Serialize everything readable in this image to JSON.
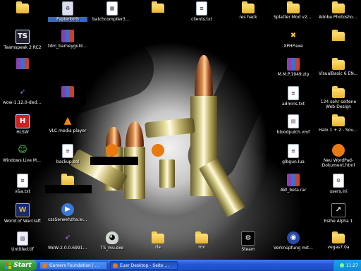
{
  "desktop": {
    "icons": [
      {
        "label": "",
        "kind": "folder",
        "icon": "folder-icon"
      },
      {
        "label": "Papierkorb",
        "kind": "bin",
        "icon": "recycle-bin-icon"
      },
      {
        "label": "batchcompiler312.exe",
        "kind": "exe",
        "icon": "batch-compiler-icon"
      },
      {
        "label": "",
        "kind": "folder",
        "icon": "folder-icon"
      },
      {
        "label": "clients.txt",
        "kind": "doc",
        "icon": "text-file-icon"
      },
      {
        "label": "res hack",
        "kind": "folder",
        "icon": "folder-icon"
      },
      {
        "label": "Splatter Mod v2.zip",
        "kind": "folder",
        "icon": "zip-folder-icon"
      },
      {
        "label": "Adobe Photoshop CS2",
        "kind": "folder",
        "icon": "folder-icon"
      },
      {
        "label": "Teamspeak 2 RC2",
        "kind": "exe",
        "icon": "teamspeak-icon"
      },
      {
        "label": "tdm_barneyguldh_fina...",
        "kind": "rar",
        "icon": "rar-archive-icon"
      },
      {
        "label": "XPHP.exe",
        "kind": "exe",
        "icon": "xphp-icon"
      },
      {
        "label": "",
        "kind": "folder",
        "icon": "folder-icon"
      },
      {
        "label": "",
        "kind": "rar",
        "icon": "rar-archive-icon"
      },
      {
        "label": "",
        "kind": "doc",
        "icon": "document-icon"
      },
      {
        "label": "M.M.P.1949.zip",
        "kind": "rar",
        "icon": "rar-archive-icon"
      },
      {
        "label": "VisualBasic 6 ENTERPRISE",
        "kind": "folder",
        "icon": "folder-icon"
      },
      {
        "label": "wow-1.12.0-dede-pat...",
        "kind": "exe",
        "icon": "wow-patch-icon"
      },
      {
        "label": "",
        "kind": "rar",
        "icon": "rar-archive-icon"
      },
      {
        "label": "admins.txt",
        "kind": "doc",
        "icon": "text-file-icon"
      },
      {
        "label": "124 sehr seltene Web-Design Schriftart...",
        "kind": "folder",
        "icon": "folder-icon"
      },
      {
        "label": "HLSW",
        "kind": "exe",
        "icon": "hlsw-icon"
      },
      {
        "label": "VLC media player",
        "kind": "exe",
        "icon": "vlc-icon"
      },
      {
        "label": "bloodpulch.vmf",
        "kind": "doc",
        "icon": "vmf-file-icon"
      },
      {
        "label": "Halo 1 + 2 - Soundtrack",
        "kind": "folder",
        "icon": "folder-icon"
      },
      {
        "label": "Windows Live Messenger",
        "kind": "exe",
        "icon": "messenger-icon"
      },
      {
        "label": "backup.sql",
        "kind": "doc",
        "icon": "sql-file-icon"
      },
      {
        "label": "",
        "kind": "exe",
        "icon": "firefox-icon"
      },
      {
        "label": "",
        "kind": "exe",
        "icon": "firefox-icon"
      },
      {
        "label": "glbgun.lua",
        "kind": "doc",
        "icon": "lua-file-icon"
      },
      {
        "label": "Neu WordPad-Dokument.html",
        "kind": "exe",
        "icon": "firefox-icon"
      },
      {
        "label": "v&a.txt",
        "kind": "doc",
        "icon": "text-file-icon"
      },
      {
        "label": "",
        "kind": "folder",
        "icon": "folder-icon"
      },
      {
        "label": "AW_beta.rar",
        "kind": "rar",
        "icon": "rar-archive-icon"
      },
      {
        "label": "users.ini",
        "kind": "doc",
        "icon": "ini-file-icon"
      },
      {
        "label": "World of Warcraft",
        "kind": "exe",
        "icon": "warcraft-icon"
      },
      {
        "label": "cssSerwehzha.wmv",
        "kind": "exe",
        "icon": "video-file-icon"
      },
      {
        "label": "Esihe Alpha 1",
        "kind": "exe",
        "icon": "steam-game-icon"
      },
      {
        "label": "Untitled.tif",
        "kind": "doc",
        "icon": "image-file-icon"
      },
      {
        "label": "WoW-2.0.0.6991-dede...",
        "kind": "exe",
        "icon": "wow-patch-icon"
      },
      {
        "label": "TS_mu.exe",
        "kind": "exe",
        "icon": "alien-icon"
      },
      {
        "label": "rla",
        "kind": "folder",
        "icon": "folder-icon"
      },
      {
        "label": "mx",
        "kind": "folder",
        "icon": "folder-icon"
      },
      {
        "label": "Steam",
        "kind": "exe",
        "icon": "steam-icon"
      },
      {
        "label": "Verknüpfung mit CINEMA 4D R8",
        "kind": "exe",
        "icon": "cinema4d-icon"
      },
      {
        "label": "",
        "kind": "folder",
        "icon": "folder-icon"
      },
      {
        "label": "vegas7.0a",
        "kind": "folder",
        "icon": "folder-icon"
      }
    ]
  },
  "taskbar": {
    "start_label": "Start",
    "tasks": [
      {
        "label": "Gamers Foundation | ...",
        "icon": "browser-icon",
        "active": false
      },
      {
        "label": "Euer Desktop - Seite ...",
        "icon": "browser-icon",
        "active": true
      }
    ],
    "clock": "11:27"
  },
  "colors": {
    "taskbar_blue": "#2457d4",
    "start_green": "#3a9a38",
    "folder_yellow": "#f0c040",
    "tray_blue": "#0f8ad8"
  }
}
